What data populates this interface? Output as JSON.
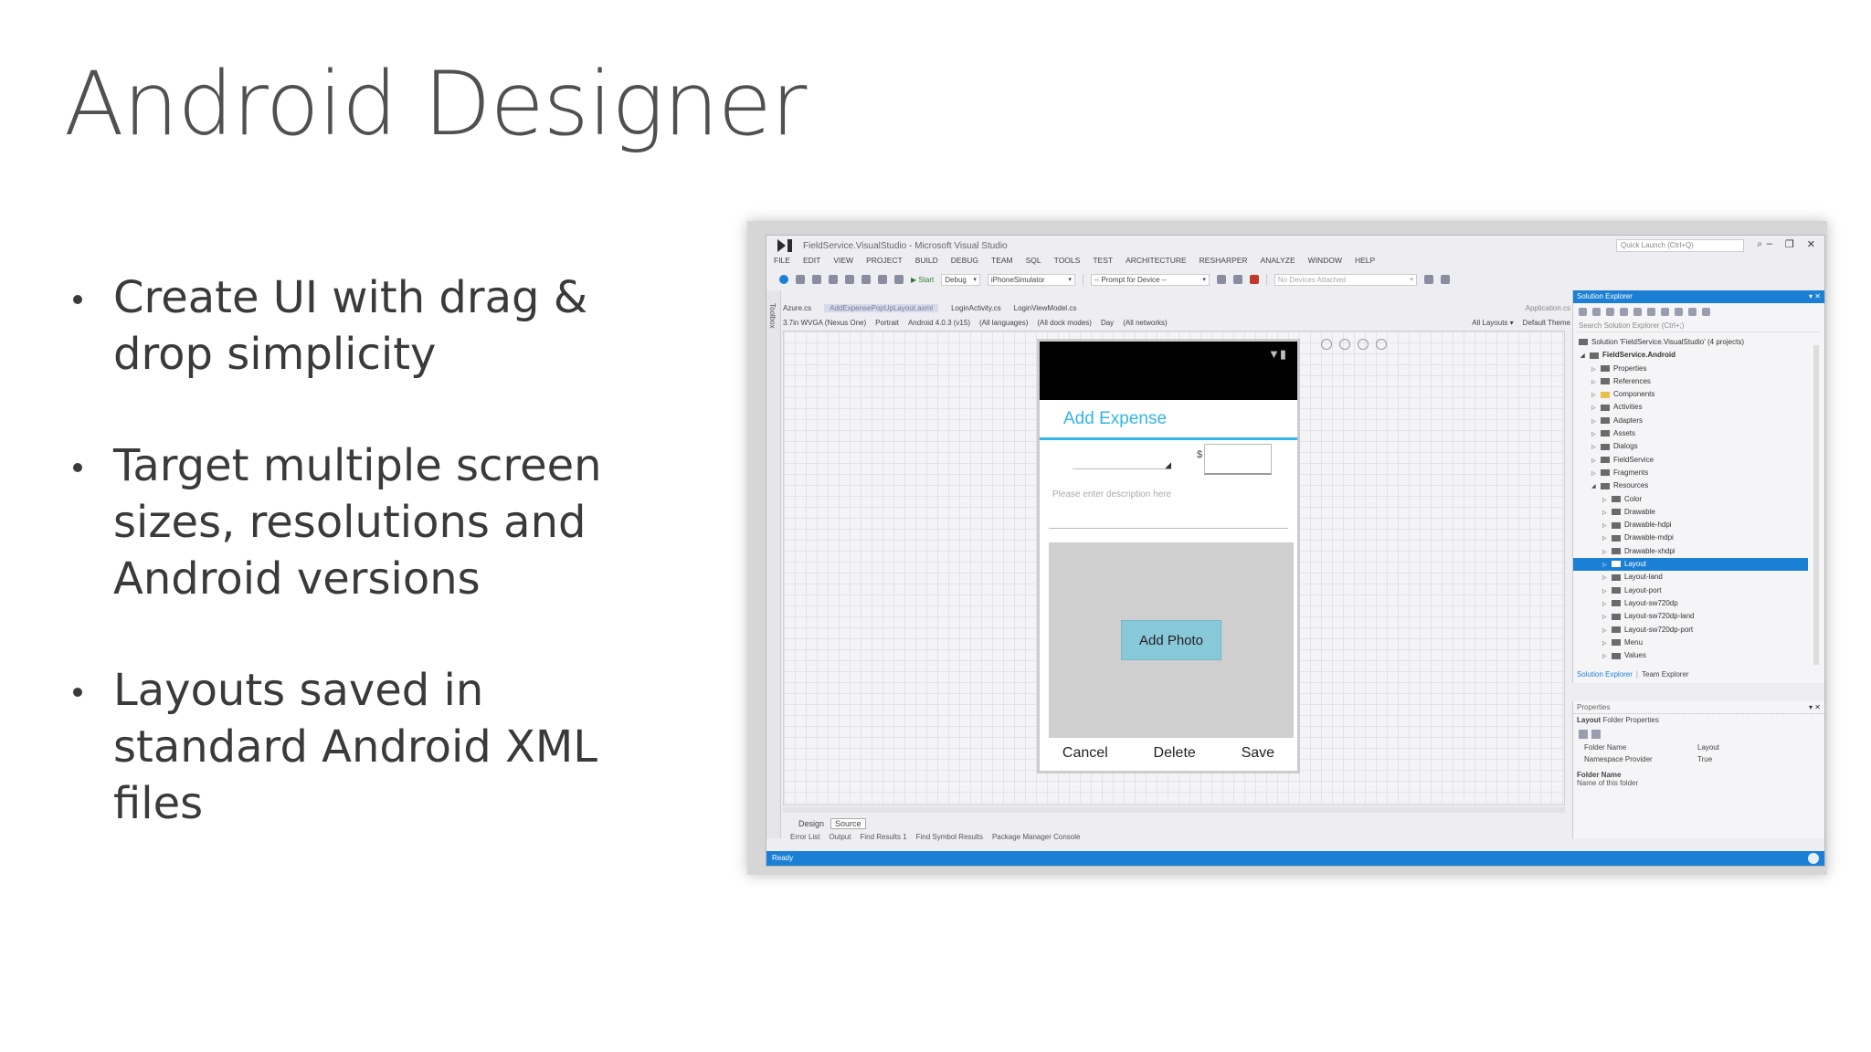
{
  "slide": {
    "title": "Android Designer",
    "bullets": [
      "Create UI with drag & drop simplicity",
      "Target multiple screen sizes, resolutions and Android versions",
      "Layouts saved in standard Android XML files"
    ]
  },
  "vs": {
    "window_title": "FieldService.VisualStudio - Microsoft Visual Studio",
    "quick_launch_placeholder": "Quick Launch (Ctrl+Q)",
    "menu": [
      "FILE",
      "EDIT",
      "VIEW",
      "PROJECT",
      "BUILD",
      "DEBUG",
      "TEAM",
      "SQL",
      "TOOLS",
      "TEST",
      "ARCHITECTURE",
      "RESHARPER",
      "ANALYZE",
      "WINDOW",
      "HELP"
    ],
    "toolbar": {
      "start": "▶ Start",
      "config": "Debug",
      "target": "iPhoneSimulator",
      "device": "-- Prompt for Device --",
      "attached": "No Devices Attached"
    },
    "toolbox_label": "Toolbox",
    "doc_tabs": {
      "t1": "Azure.cs",
      "t2": "AddExpensePopUpLayout.axml",
      "t3": "LoginActivity.cs",
      "t4": "LoginViewModel.cs",
      "t5": "Application.cs"
    },
    "config_bar": {
      "device": "3.7in WVGA (Nexus One)",
      "orientation": "Portrait",
      "api": "Android 4.0.3 (v15)",
      "language": "(All languages)",
      "dock": "(All dock modes)",
      "time": "Day",
      "network": "(All networks)",
      "layouts": "All Layouts ▾",
      "theme": "Default Theme"
    },
    "phone": {
      "action_title": "Add Expense",
      "currency": "$",
      "description_hint": "Please enter description here",
      "add_photo": "Add Photo",
      "cancel": "Cancel",
      "delete": "Delete",
      "save": "Save"
    },
    "design_tab": "Design",
    "source_tab": "Source",
    "bottom_tabs": [
      "Error List",
      "Output",
      "Find Results 1",
      "Find Symbol Results",
      "Package Manager Console"
    ],
    "solution_explorer": {
      "title": "Solution Explorer",
      "search_placeholder": "Search Solution Explorer (Ctrl+;)",
      "items": [
        "Solution 'FieldService.VisualStudio' (4 projects)",
        "FieldService.Android",
        "Properties",
        "References",
        "Components",
        "Activities",
        "Adapters",
        "Assets",
        "Dialogs",
        "FieldService",
        "Fragments",
        "Resources",
        "Color",
        "Drawable",
        "Drawable-hdpi",
        "Drawable-mdpi",
        "Drawable-xhdpi",
        "Layout",
        "Layout-land",
        "Layout-port",
        "Layout-sw720dp",
        "Layout-sw720dp-land",
        "Layout-sw720dp-port",
        "Menu",
        "Values"
      ],
      "footer_tab1": "Solution Explorer",
      "footer_tab2": "Team Explorer"
    },
    "properties": {
      "title": "Properties",
      "object": "Layout",
      "object_type": "Folder Properties",
      "row1_key": "Folder Name",
      "row1_val": "Layout",
      "row2_key": "Namespace Provider",
      "row2_val": "True",
      "desc_title": "Folder Name",
      "desc_text": "Name of this folder"
    },
    "status": "Ready",
    "accent_color": "#1c7fd6",
    "android_blue": "#33b5e5"
  }
}
